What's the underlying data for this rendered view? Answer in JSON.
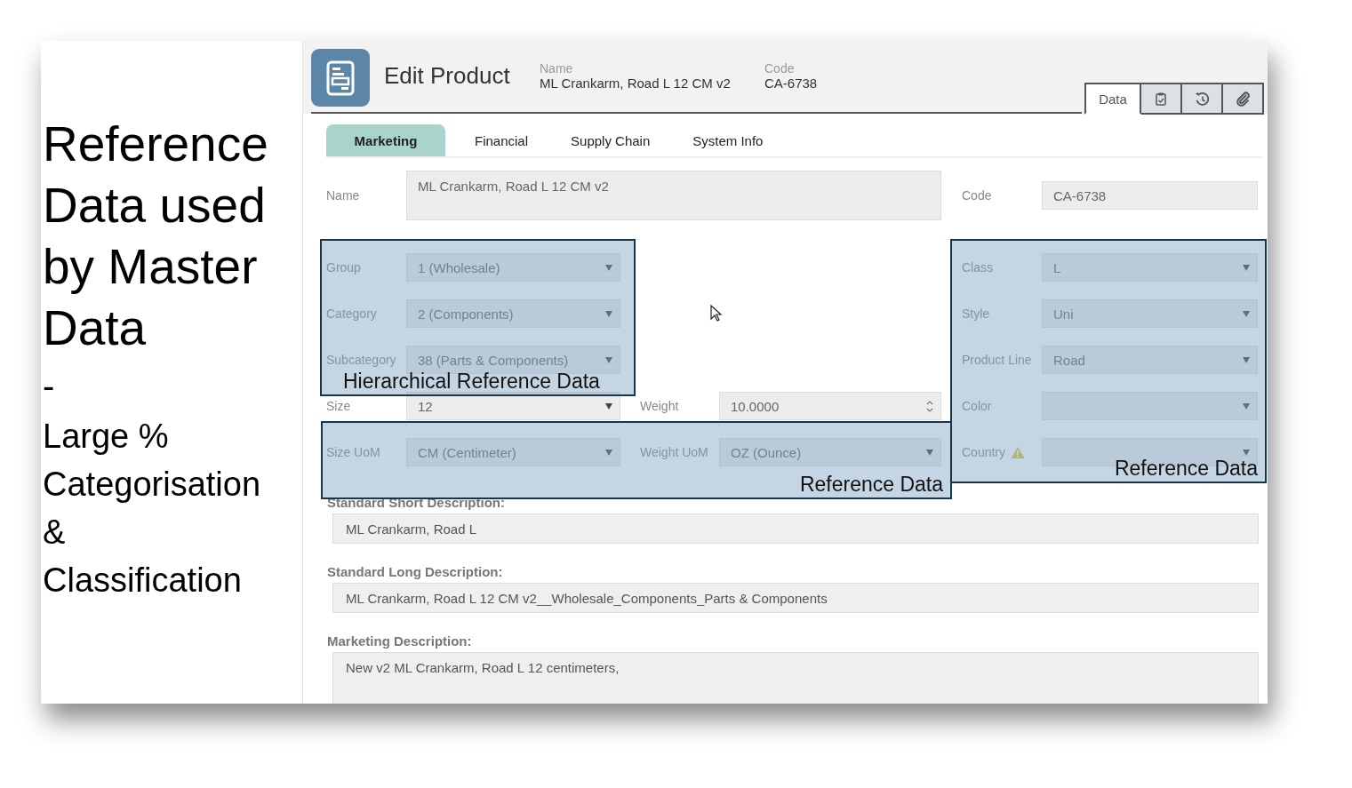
{
  "side_note": {
    "title_lines": [
      "Reference",
      "Data used",
      "by Master",
      "Data"
    ],
    "dash": "-",
    "subtitle_lines": [
      "Large %",
      "Categorisation",
      "&",
      "Classification"
    ]
  },
  "header": {
    "title": "Edit Product",
    "name_label": "Name",
    "name_value": "ML Crankarm, Road L 12 CM v2",
    "code_label": "Code",
    "code_value": "CA-6738"
  },
  "view_tabs": [
    {
      "kind": "text",
      "label": "Data",
      "selected": true
    },
    {
      "kind": "clipboard",
      "selected": false
    },
    {
      "kind": "history",
      "selected": false
    },
    {
      "kind": "attachment",
      "selected": false
    }
  ],
  "tabs": [
    {
      "label": "Marketing",
      "selected": true
    },
    {
      "label": "Financial",
      "selected": false
    },
    {
      "label": "Supply Chain",
      "selected": false
    },
    {
      "label": "System Info",
      "selected": false
    }
  ],
  "name_field": {
    "label": "Name",
    "value": "ML Crankarm, Road L 12 CM v2"
  },
  "code_field": {
    "label": "Code",
    "value": "CA-6738"
  },
  "left_fields": [
    {
      "label": "Group",
      "value": "1 (Wholesale)",
      "kind": "select"
    },
    {
      "label": "Category",
      "value": "2 (Components)",
      "kind": "select"
    },
    {
      "label": "Subcategory",
      "value": "38 (Parts & Components)",
      "kind": "select"
    },
    {
      "label": "Size",
      "value": "12",
      "kind": "select"
    },
    {
      "label": "Size UoM",
      "value": "CM (Centimeter)",
      "kind": "select"
    }
  ],
  "middle_fields": [
    {
      "label": "Weight",
      "value": "10.0000",
      "kind": "spinner"
    },
    {
      "label": "Weight UoM",
      "value": "OZ (Ounce)",
      "kind": "select"
    }
  ],
  "right_fields": [
    {
      "label": "Class",
      "value": "L",
      "kind": "select",
      "warning": false
    },
    {
      "label": "Style",
      "value": "Uni",
      "kind": "select",
      "warning": false
    },
    {
      "label": "Product Line",
      "value": "Road",
      "kind": "select",
      "warning": false
    },
    {
      "label": "Color",
      "kind": "select",
      "warning": false
    },
    {
      "label": "Country",
      "kind": "select",
      "warning": true
    }
  ],
  "descriptions": [
    {
      "label": "Standard Short Description:",
      "value": "ML Crankarm, Road L"
    },
    {
      "label": "Standard Long Description:",
      "value": "ML Crankarm, Road L 12 CM v2__Wholesale_Components_Parts & Components"
    },
    {
      "label": "Marketing Description:",
      "value": "New v2 ML Crankarm, Road L 12 centimeters,"
    }
  ],
  "annotations": [
    {
      "label": "Hierarchical Reference Data"
    },
    {
      "label": "Reference Data"
    },
    {
      "label": "Reference Data"
    }
  ]
}
